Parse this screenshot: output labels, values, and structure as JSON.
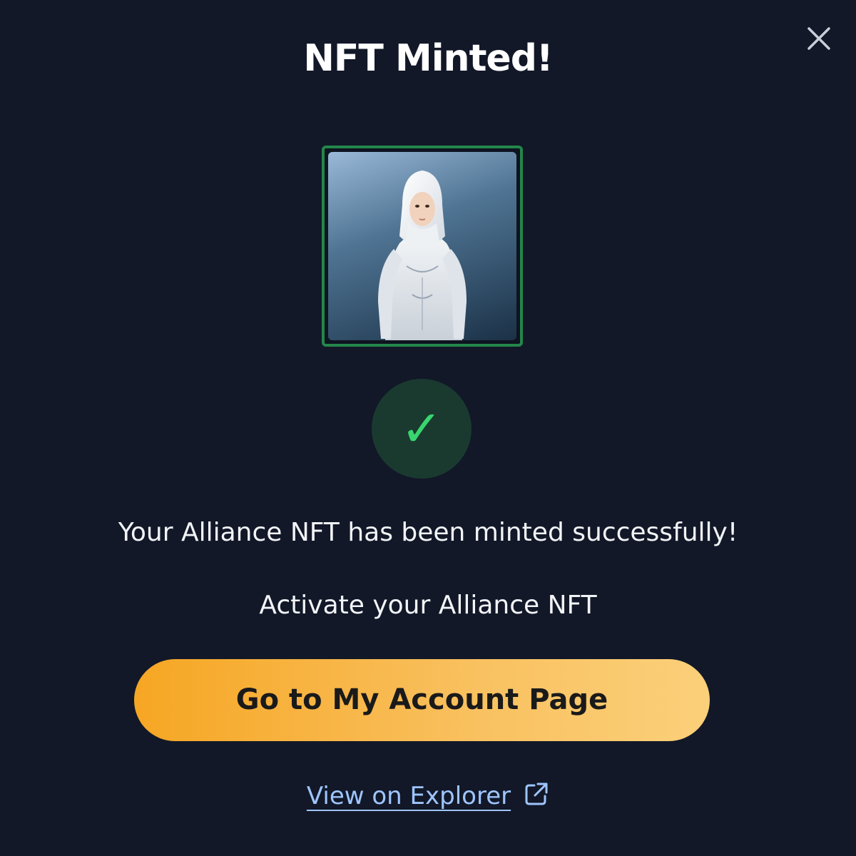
{
  "modal": {
    "title": "NFT Minted!",
    "close_icon": "close-icon"
  },
  "nft": {
    "image_description_icon": "nft-avatar-image",
    "frame_color": "#23864a"
  },
  "status": {
    "icon": "checkmark-icon",
    "glyph": "✓",
    "color": "#38d66e"
  },
  "message": {
    "success": "Your Alliance NFT has been minted successfully!",
    "activate": "Activate your Alliance NFT"
  },
  "actions": {
    "primary_label": "Go to My Account Page",
    "primary_color": "#f6a623",
    "explorer_label": "View on Explorer",
    "explorer_icon": "external-link-icon",
    "link_color": "#9ec5ff"
  },
  "colors": {
    "background": "#121828"
  }
}
